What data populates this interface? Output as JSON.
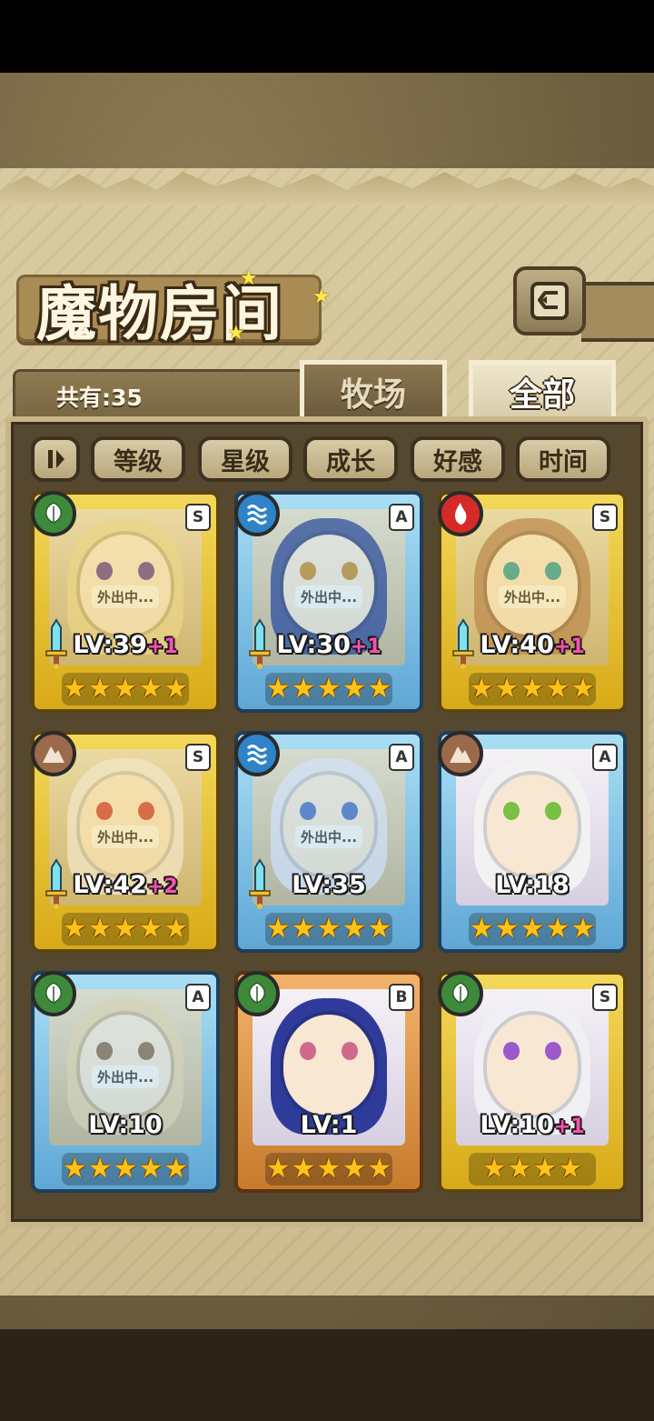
{
  "header": {
    "title": "魔物房间",
    "back_icon": "back-arrow-icon"
  },
  "count": {
    "label": "共有:35"
  },
  "tabs": [
    {
      "label": "牧场",
      "active": false
    },
    {
      "label": "全部",
      "active": true
    }
  ],
  "sort": {
    "toggle_icon": "sort-toggle-icon",
    "buttons": [
      "等级",
      "星级",
      "成长",
      "好感",
      "时间"
    ]
  },
  "cards": [
    {
      "element": "nature",
      "rank": "S",
      "frame": "gold",
      "level": "LV:39",
      "plus": "+1",
      "away": "外出中...",
      "stars": 5,
      "sword": true
    },
    {
      "element": "water",
      "rank": "A",
      "frame": "blue",
      "level": "LV:30",
      "plus": "+1",
      "away": "外出中...",
      "stars": 5,
      "sword": true
    },
    {
      "element": "fire",
      "rank": "S",
      "frame": "gold",
      "level": "LV:40",
      "plus": "+1",
      "away": "外出中...",
      "stars": 5,
      "sword": true
    },
    {
      "element": "earth",
      "rank": "S",
      "frame": "gold",
      "level": "LV:42",
      "plus": "+2",
      "away": "外出中...",
      "stars": 5,
      "sword": true
    },
    {
      "element": "water",
      "rank": "A",
      "frame": "blue",
      "level": "LV:35",
      "plus": "",
      "away": "外出中...",
      "stars": 5,
      "sword": true
    },
    {
      "element": "earth",
      "rank": "A",
      "frame": "blue",
      "level": "LV:18",
      "plus": "",
      "away": "",
      "stars": 5,
      "sword": false
    },
    {
      "element": "nature",
      "rank": "A",
      "frame": "blue",
      "level": "LV:10",
      "plus": "",
      "away": "外出中...",
      "stars": 5,
      "sword": false
    },
    {
      "element": "nature",
      "rank": "B",
      "frame": "bronze",
      "level": "LV:1",
      "plus": "",
      "away": "",
      "stars": 5,
      "sword": false
    },
    {
      "element": "nature",
      "rank": "S",
      "frame": "gold",
      "level": "LV:10",
      "plus": "+1",
      "away": "",
      "stars": 4,
      "sword": false
    }
  ],
  "colors": {
    "gold_frame": "#f3d95a",
    "blue_frame": "#a9dff4",
    "bronze_frame": "#f2b36a",
    "star": "#ffc21a",
    "plus_text": "#ff4fb2"
  }
}
